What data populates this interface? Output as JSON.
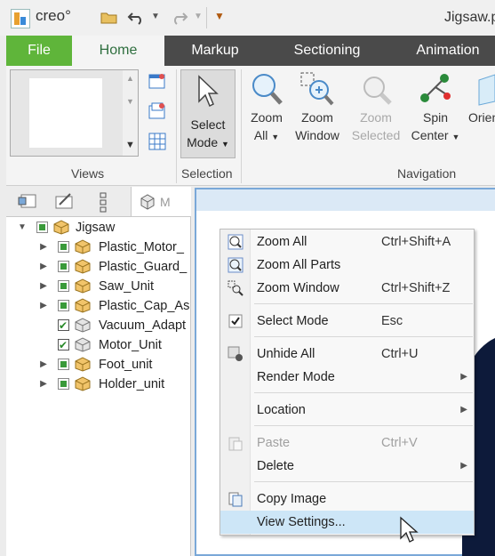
{
  "app": {
    "logo_text": "creo°",
    "window_title": "Jigsaw.p"
  },
  "tabs": [
    {
      "label": "File"
    },
    {
      "label": "Home"
    },
    {
      "label": "Markup"
    },
    {
      "label": "Sectioning"
    },
    {
      "label": "Animation"
    }
  ],
  "ribbon": {
    "groups": {
      "views": "Views",
      "selection": "Selection",
      "navigation": "Navigation"
    },
    "select_mode": {
      "line1": "Select",
      "line2": "Mode"
    },
    "zoom_all": {
      "line1": "Zoom",
      "line2": "All"
    },
    "zoom_window": {
      "line1": "Zoom",
      "line2": "Window"
    },
    "zoom_selected": {
      "line1": "Zoom",
      "line2": "Selected"
    },
    "spin_center": {
      "line1": "Spin",
      "line2": "Center"
    },
    "orient": {
      "line1": "Orien"
    }
  },
  "panel": {
    "model_tab_label": "M",
    "tree": [
      {
        "label": "Jigsaw"
      },
      {
        "label": "Plastic_Motor_"
      },
      {
        "label": "Plastic_Guard_"
      },
      {
        "label": "Saw_Unit"
      },
      {
        "label": "Plastic_Cap_As"
      },
      {
        "label": "Vacuum_Adapt"
      },
      {
        "label": "Motor_Unit"
      },
      {
        "label": "Foot_unit"
      },
      {
        "label": "Holder_unit"
      }
    ]
  },
  "context_menu": {
    "items": [
      {
        "label": "Zoom All",
        "shortcut": "Ctrl+Shift+A"
      },
      {
        "label": "Zoom All Parts",
        "shortcut": ""
      },
      {
        "label": "Zoom Window",
        "shortcut": "Ctrl+Shift+Z"
      },
      {
        "label": "Select Mode",
        "shortcut": "Esc"
      },
      {
        "label": "Unhide All",
        "shortcut": "Ctrl+U"
      },
      {
        "label": "Render Mode",
        "shortcut": ""
      },
      {
        "label": "Location",
        "shortcut": ""
      },
      {
        "label": "Paste",
        "shortcut": "Ctrl+V"
      },
      {
        "label": "Delete",
        "shortcut": ""
      },
      {
        "label": "Copy Image",
        "shortcut": ""
      },
      {
        "label": "View Settings...",
        "shortcut": ""
      }
    ]
  },
  "colors": {
    "file_tab": "#5fb53a",
    "tab_bar": "#4a4a4a",
    "menu_highlight": "#cde6f7",
    "viewport_border": "#7aa8d8"
  }
}
